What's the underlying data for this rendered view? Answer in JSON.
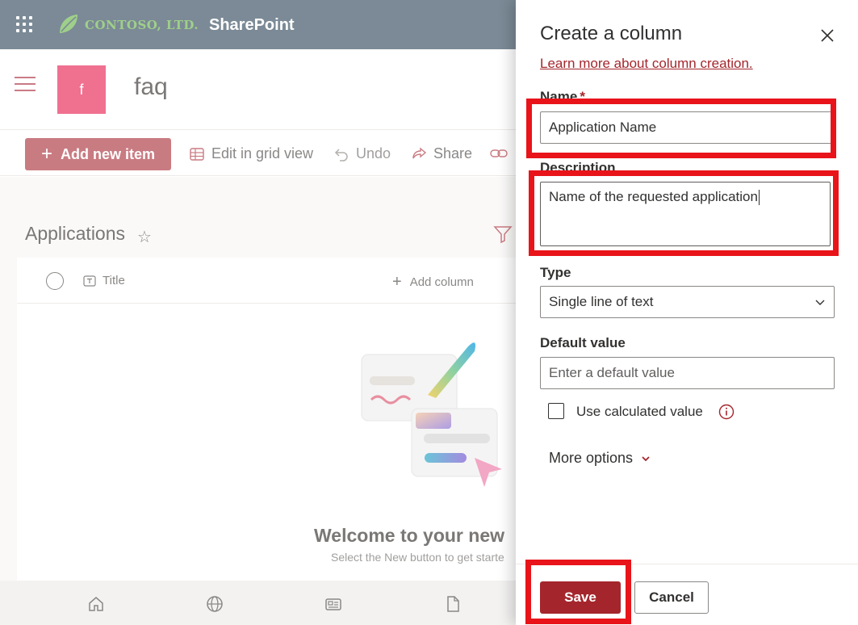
{
  "suite": {
    "logo_text": "CONTOSO, LTD.",
    "app_name": "SharePoint"
  },
  "site": {
    "logo_letter": "f",
    "title": "faq"
  },
  "commands": {
    "add_new_item": "Add new item",
    "edit_grid": "Edit in grid view",
    "undo": "Undo",
    "share": "Share"
  },
  "list": {
    "title": "Applications",
    "col_title": "Title",
    "add_column": "Add column",
    "welcome": "Welcome to your new",
    "welcome_sub": "Select the New button to get starte"
  },
  "panel": {
    "title": "Create a column",
    "learn_link": "Learn more about column creation.",
    "name_label": "Name",
    "name_required": "*",
    "name_value": "Application Name",
    "description_label": "Description",
    "description_value": "Name of the requested application",
    "type_label": "Type",
    "type_value": "Single line of text",
    "default_label": "Default value",
    "default_placeholder": "Enter a default value",
    "calc_label": "Use calculated value",
    "more_options": "More options",
    "save": "Save",
    "cancel": "Cancel"
  },
  "colors": {
    "suitebar": "#7b8a96",
    "accent": "#a4262c",
    "highlight": "#e8141a"
  }
}
